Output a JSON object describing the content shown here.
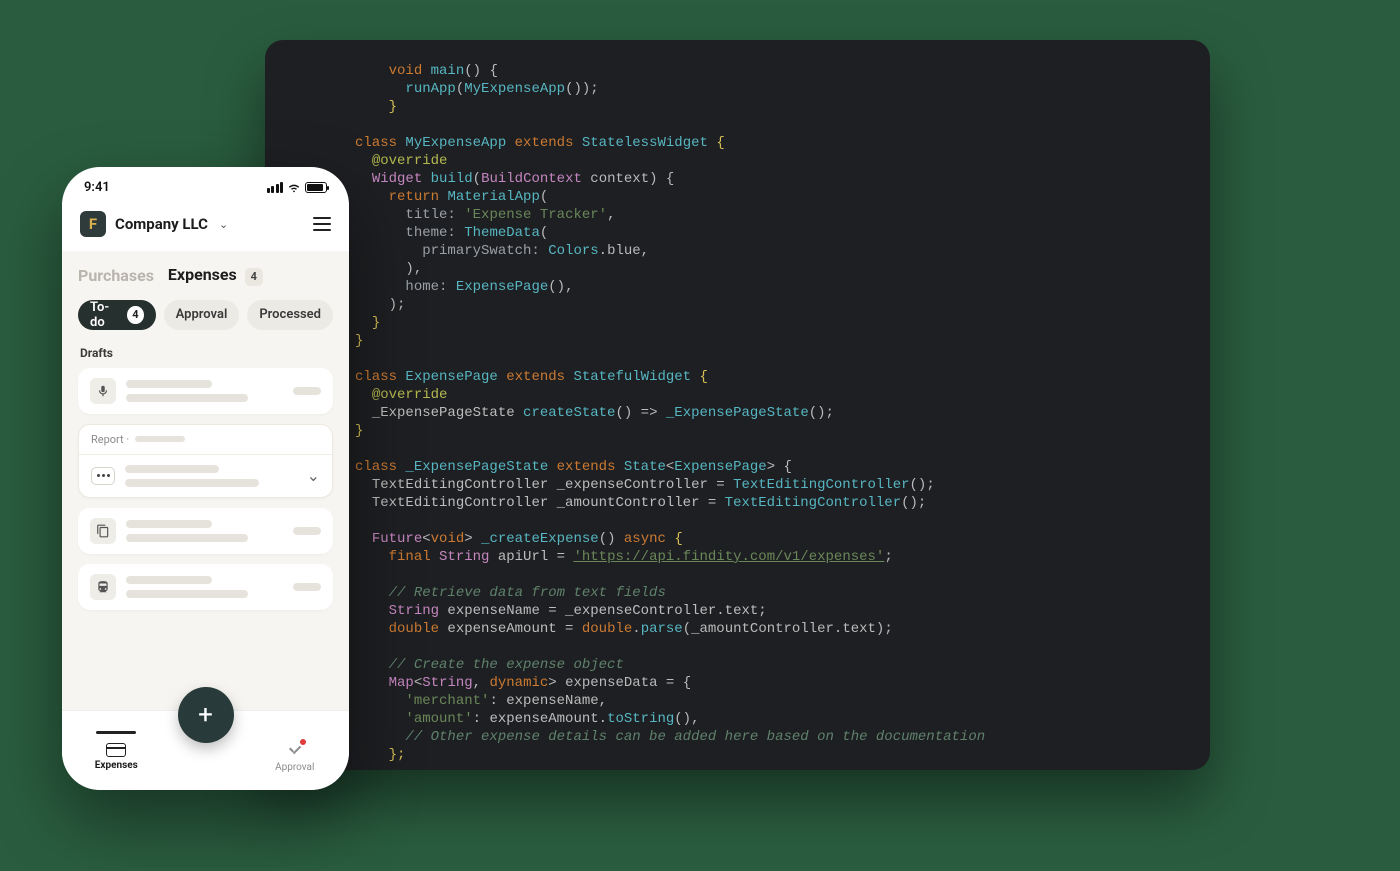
{
  "phone": {
    "status": {
      "time": "9:41"
    },
    "company": "Company LLC",
    "topTabs": {
      "purchases": "Purchases",
      "expenses": "Expenses",
      "expensesBadge": "4"
    },
    "chips": {
      "todo": "To-do",
      "todoBadge": "4",
      "approval": "Approval",
      "processed": "Processed"
    },
    "sections": {
      "drafts": "Drafts",
      "reportPrefix": "Report ·"
    },
    "nav": {
      "expenses": "Expenses",
      "approval": "Approval",
      "plus": "+"
    }
  },
  "code": {
    "l1": {
      "a": "void",
      "b": "main",
      "c": "() {"
    },
    "l2": {
      "a": "runApp",
      "b": "(",
      "c": "MyExpenseApp",
      "d": "());"
    },
    "l3": "}",
    "l5": {
      "a": "class",
      "b": "MyExpenseApp",
      "c": "extends",
      "d": "StatelessWidget",
      "e": "{"
    },
    "l6": "@override",
    "l7": {
      "a": "Widget",
      "b": "build",
      "c": "(",
      "d": "BuildContext",
      "e": " context) {"
    },
    "l8": {
      "a": "return",
      "b": "MaterialApp",
      "c": "("
    },
    "l9": {
      "a": "title:",
      "b": "'Expense Tracker'",
      "c": ","
    },
    "l10": {
      "a": "theme:",
      "b": "ThemeData",
      "c": "("
    },
    "l11": {
      "a": "primarySwatch:",
      "b": "Colors",
      "c": ".blue,"
    },
    "l12": "),",
    "l13": {
      "a": "home:",
      "b": "ExpensePage",
      "c": "(),"
    },
    "l14": ");",
    "l15": "}",
    "l16": "}",
    "l18": {
      "a": "class",
      "b": "ExpensePage",
      "c": "extends",
      "d": "StatefulWidget",
      "e": "{"
    },
    "l19": "@override",
    "l20": {
      "a": "_ExpensePageState ",
      "b": "createState",
      "c": "() => ",
      "d": "_ExpensePageState",
      "e": "();"
    },
    "l21": "}",
    "l23": {
      "a": "class",
      "b": "_ExpensePageState",
      "c": "extends",
      "d": "State",
      "e": "<",
      "f": "ExpensePage",
      "g": "> {"
    },
    "l24": {
      "a": "TextEditingController _expenseController = ",
      "b": "TextEditingController",
      "c": "();"
    },
    "l25": {
      "a": "TextEditingController _amountController = ",
      "b": "TextEditingController",
      "c": "();"
    },
    "l27": {
      "a": "Future",
      "b": "<",
      "c": "void",
      "d": "> ",
      "e": "_createExpense",
      "f": "() ",
      "g": "async",
      "h": " {"
    },
    "l28": {
      "a": "final",
      "b": "String",
      "c": " apiUrl = ",
      "d": "'https://api.findity.com/v1/expenses'",
      "e": ";"
    },
    "l30": "// Retrieve data from text fields",
    "l31": {
      "a": "String",
      "b": " expenseName = _expenseController.text;"
    },
    "l32": {
      "a": "double",
      "b": " expenseAmount = ",
      "c": "double",
      "d": ".",
      "e": "parse",
      "f": "(_amountController.text);"
    },
    "l34": "// Create the expense object",
    "l35": {
      "a": "Map",
      "b": "<",
      "c": "String",
      "d": ", ",
      "e": "dynamic",
      "f": "> expenseData = {"
    },
    "l36": {
      "a": "'merchant'",
      "b": ": expenseName,"
    },
    "l37": {
      "a": "'amount'",
      "b": ": expenseAmount.",
      "c": "toString",
      "d": "(),"
    },
    "l38": "// Other expense details can be added here based on the documentation",
    "l39": "};"
  }
}
